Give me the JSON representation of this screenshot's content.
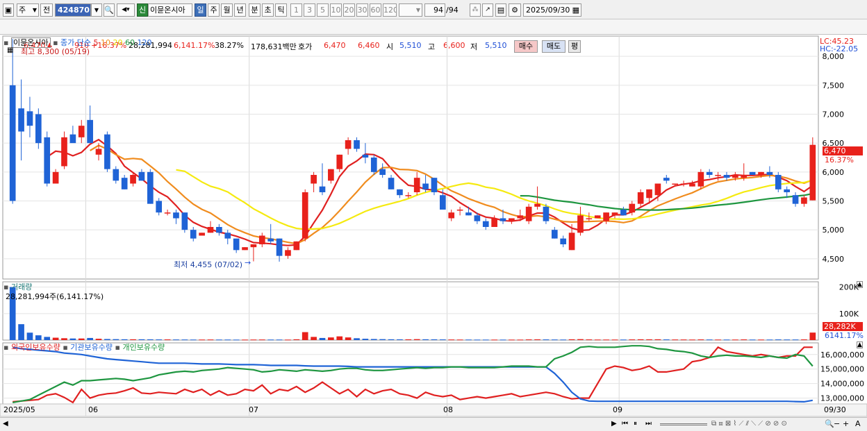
{
  "toolbar": {
    "period_select": "주",
    "compare_label": "전",
    "code": "424870",
    "new_badge": "신",
    "stock_name": "이뮨온시아",
    "periods": [
      "일",
      "주",
      "월",
      "년",
      "분",
      "초",
      "틱"
    ],
    "active_period": "일",
    "intervals": [
      "1",
      "3",
      "5",
      "10",
      "20",
      "30",
      "60",
      "120"
    ],
    "count": "94",
    "count_total": "/94",
    "date": "2025/09/30"
  },
  "quote": {
    "price": "6,470",
    "change": "910",
    "change_pct": "+16.37%",
    "volume": "28,281,994",
    "volume_ratio": "6,141.17%",
    "turnover": "38.27%",
    "amount": "178,631백만",
    "hoga_label": "호가",
    "ask": "6,470",
    "bid": "6,460",
    "open_label": "시",
    "open": "5,510",
    "high_label": "고",
    "high": "6,600",
    "low_label": "저",
    "low": "5,510",
    "buy_button": "매수",
    "sell_button": "매도",
    "eval_button": "평"
  },
  "price_panel": {
    "title": "이뮨온시아",
    "ma_label": "종가 단순",
    "ma_periods": [
      "5",
      "10",
      "20",
      "60",
      "120"
    ],
    "high_note": "최고 8,300 (05/19)",
    "low_note": "최저 4,455 (07/02)",
    "lc": "LC:45.23",
    "hc": "HC:-22.05",
    "last_price_tag": "6,470",
    "last_pct_tag": "16.37%"
  },
  "volume_panel": {
    "title": "거래량",
    "value_note": "28,281,994주(6,141.17%)",
    "tag_value": "28,282K",
    "tag_pct": "6141.17%"
  },
  "holding_panel": {
    "legend": [
      "외국인보유수량",
      "기관보유수량",
      "개인보유수량"
    ]
  },
  "x_labels": [
    "2025/05",
    "06",
    "07",
    "08",
    "09",
    "09/30"
  ],
  "colors": {
    "up": "#e8211b",
    "down": "#1f63d6",
    "ma5": "#e02020",
    "ma10": "#f08c1e",
    "ma20": "#f5ea10",
    "ma60": "#1e9640",
    "ma120": "#1f63d6"
  },
  "chart_data": [
    {
      "type": "candlestick",
      "title": "이뮨온시아",
      "y_ticks": [
        8000,
        7500,
        7000,
        6500,
        6000,
        5500,
        5000,
        4500
      ],
      "ylim": [
        4150,
        8350
      ],
      "ohlc": [
        [
          7500,
          8300,
          5450,
          5500
        ],
        [
          7100,
          7600,
          6200,
          6700
        ],
        [
          7050,
          7300,
          6600,
          6800
        ],
        [
          7000,
          7100,
          6400,
          6500
        ],
        [
          6600,
          6700,
          5750,
          5800
        ],
        [
          5800,
          6050,
          5800,
          6000
        ],
        [
          6100,
          6700,
          6050,
          6600
        ],
        [
          6650,
          6800,
          6550,
          6500
        ],
        [
          6600,
          6900,
          6500,
          6800
        ],
        [
          6900,
          7150,
          6800,
          6500
        ],
        [
          6300,
          6500,
          6200,
          6400
        ],
        [
          6650,
          6700,
          6000,
          6050
        ],
        [
          6050,
          6100,
          5800,
          5850
        ],
        [
          5900,
          5950,
          5700,
          5700
        ],
        [
          5800,
          6000,
          5750,
          5950
        ],
        [
          6000,
          6050,
          5850,
          5850
        ],
        [
          6000,
          6050,
          5450,
          5450
        ],
        [
          5500,
          5550,
          5250,
          5300
        ],
        [
          5300,
          5350,
          5250,
          5300
        ],
        [
          5300,
          5350,
          5100,
          5200
        ],
        [
          5300,
          5300,
          4950,
          5000
        ],
        [
          5000,
          5050,
          4800,
          4850
        ],
        [
          4900,
          4950,
          4900,
          4950
        ],
        [
          4950,
          5150,
          4950,
          5050
        ],
        [
          5050,
          5100,
          4900,
          4950
        ],
        [
          4950,
          5000,
          4750,
          4850
        ],
        [
          4850,
          4850,
          4600,
          4650
        ],
        [
          4650,
          4700,
          4650,
          4700
        ],
        [
          4700,
          4750,
          4455,
          4750
        ],
        [
          4750,
          4950,
          4700,
          4900
        ],
        [
          4850,
          5100,
          4750,
          4800
        ],
        [
          4850,
          4850,
          4450,
          4550
        ],
        [
          4550,
          4700,
          4500,
          4650
        ],
        [
          4650,
          4800,
          4650,
          4800
        ],
        [
          4850,
          5700,
          4800,
          5650
        ],
        [
          5800,
          6000,
          5650,
          5950
        ],
        [
          5750,
          6150,
          5600,
          5650
        ],
        [
          5850,
          6050,
          5800,
          6050
        ],
        [
          6050,
          6300,
          6000,
          6300
        ],
        [
          6400,
          6600,
          6300,
          6550
        ],
        [
          6550,
          6600,
          6350,
          6400
        ],
        [
          6300,
          6500,
          6150,
          6250
        ],
        [
          6250,
          6300,
          5950,
          6000
        ],
        [
          6050,
          6150,
          5900,
          5950
        ],
        [
          5900,
          5950,
          5700,
          5700
        ],
        [
          5700,
          5700,
          5550,
          5600
        ],
        [
          5600,
          5650,
          5550,
          5600
        ],
        [
          5650,
          6000,
          5600,
          5900
        ],
        [
          5800,
          5950,
          5650,
          5700
        ],
        [
          5900,
          5900,
          5600,
          5650
        ],
        [
          5600,
          5700,
          5350,
          5350
        ],
        [
          5200,
          5350,
          5150,
          5300
        ],
        [
          5350,
          5400,
          5250,
          5350
        ],
        [
          5300,
          5400,
          5250,
          5250
        ],
        [
          5250,
          5300,
          5100,
          5150
        ],
        [
          5150,
          5200,
          5000,
          5050
        ],
        [
          5050,
          5250,
          5050,
          5200
        ],
        [
          5200,
          5350,
          5100,
          5150
        ],
        [
          5150,
          5200,
          5100,
          5200
        ],
        [
          5200,
          5350,
          5150,
          5250
        ],
        [
          5150,
          5450,
          5100,
          5400
        ],
        [
          5400,
          5750,
          5350,
          5450
        ],
        [
          5400,
          5450,
          5100,
          5150
        ],
        [
          5000,
          5050,
          4850,
          4850
        ],
        [
          4850,
          4900,
          4700,
          4750
        ],
        [
          4650,
          5100,
          4650,
          4950
        ],
        [
          4950,
          5400,
          4900,
          5250
        ],
        [
          5200,
          5300,
          5150,
          5200
        ],
        [
          5200,
          5250,
          5200,
          5250
        ],
        [
          5150,
          5300,
          5100,
          5300
        ],
        [
          5250,
          5300,
          5200,
          5300
        ],
        [
          5350,
          5400,
          5250,
          5250
        ],
        [
          5300,
          5500,
          5250,
          5450
        ],
        [
          5450,
          5700,
          5400,
          5650
        ],
        [
          5550,
          5700,
          5450,
          5700
        ],
        [
          5600,
          5800,
          5500,
          5800
        ],
        [
          5900,
          5950,
          5800,
          5850
        ],
        [
          5800,
          5800,
          5750,
          5800
        ],
        [
          5800,
          5850,
          5750,
          5800
        ],
        [
          5750,
          5850,
          5750,
          5800
        ],
        [
          5750,
          6050,
          5700,
          6000
        ],
        [
          6000,
          6050,
          5900,
          5950
        ],
        [
          5950,
          6000,
          5850,
          5950
        ],
        [
          5950,
          6000,
          5850,
          5900
        ],
        [
          5900,
          6000,
          5850,
          5950
        ],
        [
          5900,
          6150,
          5850,
          5950
        ],
        [
          6000,
          6000,
          5950,
          5950
        ],
        [
          5950,
          6000,
          5900,
          6000
        ],
        [
          6000,
          6100,
          5900,
          5950
        ],
        [
          5950,
          6000,
          5650,
          5700
        ],
        [
          5700,
          5750,
          5550,
          5650
        ],
        [
          5600,
          5650,
          5400,
          5450
        ],
        [
          5450,
          5600,
          5400,
          5560
        ],
        [
          5510,
          6600,
          5510,
          6470
        ]
      ]
    },
    {
      "type": "bar",
      "title": "거래량",
      "y_ticks": [
        200000,
        100000
      ],
      "ylim": [
        0,
        220000
      ],
      "unit": "K",
      "values": [
        200000,
        60000,
        28000,
        18000,
        12000,
        9000,
        7000,
        6000,
        6000,
        8000,
        5000,
        4000,
        3500,
        3000,
        3000,
        3000,
        2800,
        2500,
        2500,
        2300,
        2200,
        2000,
        2000,
        2200,
        2000,
        2000,
        1800,
        1800,
        2000,
        2200,
        2000,
        2000,
        1800,
        3000,
        30000,
        12000,
        8000,
        10000,
        14000,
        10000,
        7000,
        5000,
        4000,
        3500,
        3000,
        2800,
        2800,
        3500,
        3000,
        2800,
        2500,
        2200,
        2000,
        2000,
        1800,
        1800,
        1800,
        1800,
        1800,
        1800,
        2500,
        2800,
        2500,
        2200,
        2000,
        3000,
        3500,
        2500,
        2000,
        2000,
        2000,
        2000,
        2500,
        3000,
        2800,
        3000,
        2500,
        2200,
        2200,
        2000,
        2500,
        2200,
        2000,
        2000,
        2000,
        2500,
        2000,
        2000,
        2000,
        2500,
        2200,
        2200,
        2500,
        28282
      ]
    },
    {
      "type": "line",
      "title": "",
      "y_ticks": [
        16000000,
        15000000,
        14000000,
        13000000
      ],
      "ylim": [
        12600000,
        16800000
      ],
      "series": [
        {
          "name": "외국인보유수량",
          "values": [
            12750000,
            12800000,
            12850000,
            12900000,
            13200000,
            13300000,
            13050000,
            12700000,
            13600000,
            13000000,
            13200000,
            13300000,
            13350000,
            13500000,
            13700000,
            13350000,
            13300000,
            13400000,
            13350000,
            13300000,
            13600000,
            13400000,
            13600000,
            13200000,
            13500000,
            13200000,
            13300000,
            13600000,
            13500000,
            13900000,
            13300000,
            13600000,
            13500000,
            13800000,
            13400000,
            13700000,
            14100000,
            13700000,
            13300000,
            13600000,
            13100000,
            13600000,
            13300000,
            13500000,
            13600000,
            13300000,
            13200000,
            13000000,
            13400000,
            13200000,
            13100000,
            13200000,
            12900000,
            13000000,
            13100000,
            13000000,
            13100000,
            13200000,
            13300000,
            13100000,
            13200000,
            13300000,
            13400000,
            13300000,
            13100000,
            12950000,
            13000000,
            13000000,
            14000000,
            15000000,
            15200000,
            15100000,
            14900000,
            15000000,
            15200000,
            14800000,
            14800000,
            14900000,
            15000000,
            15500000,
            15600000,
            15800000,
            16500000,
            16200000,
            16100000,
            16000000,
            15900000,
            16000000,
            15900000,
            15800000,
            15900000,
            15900000,
            16500000,
            16500000
          ]
        },
        {
          "name": "기관보유수량",
          "values": [
            16500000,
            16400000,
            16350000,
            16300000,
            16250000,
            16200000,
            16100000,
            16050000,
            16000000,
            15900000,
            15800000,
            15700000,
            15650000,
            15600000,
            15550000,
            15500000,
            15450000,
            15400000,
            15400000,
            15400000,
            15400000,
            15380000,
            15350000,
            15350000,
            15350000,
            15330000,
            15300000,
            15300000,
            15300000,
            15280000,
            15250000,
            15250000,
            15250000,
            15250000,
            15220000,
            15200000,
            15200000,
            15200000,
            15200000,
            15180000,
            15150000,
            15150000,
            15150000,
            15150000,
            15150000,
            15150000,
            15150000,
            15150000,
            15150000,
            15150000,
            15150000,
            15150000,
            15150000,
            15150000,
            15150000,
            15150000,
            15150000,
            15150000,
            15150000,
            15150000,
            15150000,
            15150000,
            15150000,
            14700000,
            14100000,
            13400000,
            12950000,
            12800000,
            12780000,
            12780000,
            12780000,
            12780000,
            12780000,
            12780000,
            12780000,
            12780000,
            12780000,
            12780000,
            12780000,
            12780000,
            12780000,
            12780000,
            12780000,
            12780000,
            12780000,
            12780000,
            12780000,
            12780000,
            12780000,
            12780000,
            12780000,
            12760000,
            12750000,
            12850000
          ]
        },
        {
          "name": "개인보유수량",
          "values": [
            12700000,
            12800000,
            12900000,
            13200000,
            13500000,
            13800000,
            14100000,
            13900000,
            14200000,
            14200000,
            14250000,
            14300000,
            14350000,
            14300000,
            14200000,
            14300000,
            14400000,
            14600000,
            14700000,
            14800000,
            14850000,
            14800000,
            14900000,
            14950000,
            15000000,
            15100000,
            15050000,
            15000000,
            14950000,
            14800000,
            14850000,
            14950000,
            14900000,
            14850000,
            14950000,
            14900000,
            14850000,
            14900000,
            15000000,
            15050000,
            15050000,
            14950000,
            14900000,
            14900000,
            14950000,
            15000000,
            15050000,
            15100000,
            15050000,
            15100000,
            15100000,
            15150000,
            15150000,
            15100000,
            15100000,
            15100000,
            15100000,
            15150000,
            15200000,
            15200000,
            15200000,
            15150000,
            15150000,
            15700000,
            15900000,
            16150000,
            16500000,
            16550000,
            16500000,
            16500000,
            16500000,
            16550000,
            16600000,
            16600000,
            16550000,
            16400000,
            16350000,
            16250000,
            16200000,
            16100000,
            15900000,
            15800000,
            15900000,
            15950000,
            15900000,
            15900000,
            15850000,
            15800000,
            15900000,
            15800000,
            15750000,
            16000000,
            15900000,
            15200000
          ]
        }
      ]
    }
  ]
}
